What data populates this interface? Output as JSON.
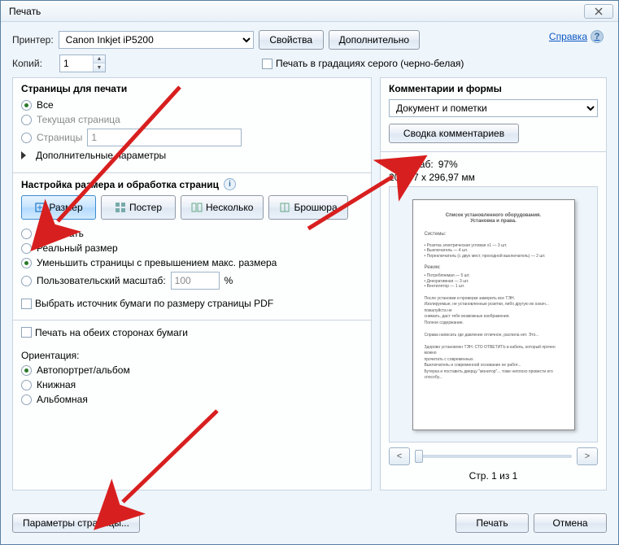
{
  "window": {
    "title": "Печать"
  },
  "header": {
    "printer_label": "Принтер:",
    "printer_value": "Canon Inkjet iP5200",
    "properties_btn": "Свойства",
    "advanced_btn": "Дополнительно",
    "copies_label": "Копий:",
    "copies_value": "1",
    "grayscale_label": "Печать в градациях серого (черно-белая)",
    "help_link": "Справка"
  },
  "pages": {
    "title": "Страницы для печати",
    "all": "Все",
    "current": "Текущая страница",
    "range_label": "Страницы",
    "range_value": "1",
    "more": "Дополнительные параметры"
  },
  "sizing": {
    "title": "Настройка размера и обработка страниц",
    "tab_size": "Размер",
    "tab_poster": "Постер",
    "tab_multi": "Несколько",
    "tab_booklet": "Брошюра",
    "fit": "Подогнать",
    "actual": "Реальный размер",
    "shrink": "Уменьшить страницы с превышением макс. размера",
    "custom": "Пользовательский масштаб:",
    "custom_value": "100",
    "custom_pct": "%",
    "paper_source": "Выбрать источник бумаги по размеру страницы PDF"
  },
  "duplex": {
    "both_sides": "Печать на обеих сторонах бумаги",
    "orientation_label": "Ориентация:",
    "auto": "Автопортрет/альбом",
    "portrait": "Книжная",
    "landscape": "Альбомная"
  },
  "comments": {
    "title": "Комментарии и формы",
    "dropdown": "Документ и пометки",
    "summary_btn": "Сводка комментариев"
  },
  "preview": {
    "scale_label": "Масштаб:",
    "scale_value": "97%",
    "dimensions": "209,97 x 296,97 мм",
    "page_of": "Стр. 1 из 1"
  },
  "footer": {
    "page_setup": "Параметры страницы...",
    "print_btn": "Печать",
    "cancel_btn": "Отмена"
  }
}
